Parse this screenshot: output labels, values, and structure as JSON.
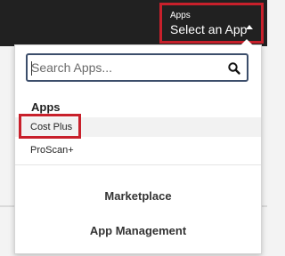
{
  "header": {
    "app_switcher": {
      "small_label": "Apps",
      "current": "Select an App"
    }
  },
  "dropdown": {
    "search": {
      "placeholder": "Search Apps...",
      "value": ""
    },
    "apps_heading": "Apps",
    "apps": [
      {
        "label": "Cost Plus",
        "highlighted": true
      },
      {
        "label": "ProScan+",
        "highlighted": false
      }
    ],
    "links": [
      {
        "label": "Marketplace"
      },
      {
        "label": "App Management"
      }
    ]
  },
  "colors": {
    "topbar": "#212121",
    "highlight": "#c8202b",
    "search_border": "#3c4e6b"
  },
  "icons": [
    "caret-up-icon",
    "search-icon"
  ]
}
